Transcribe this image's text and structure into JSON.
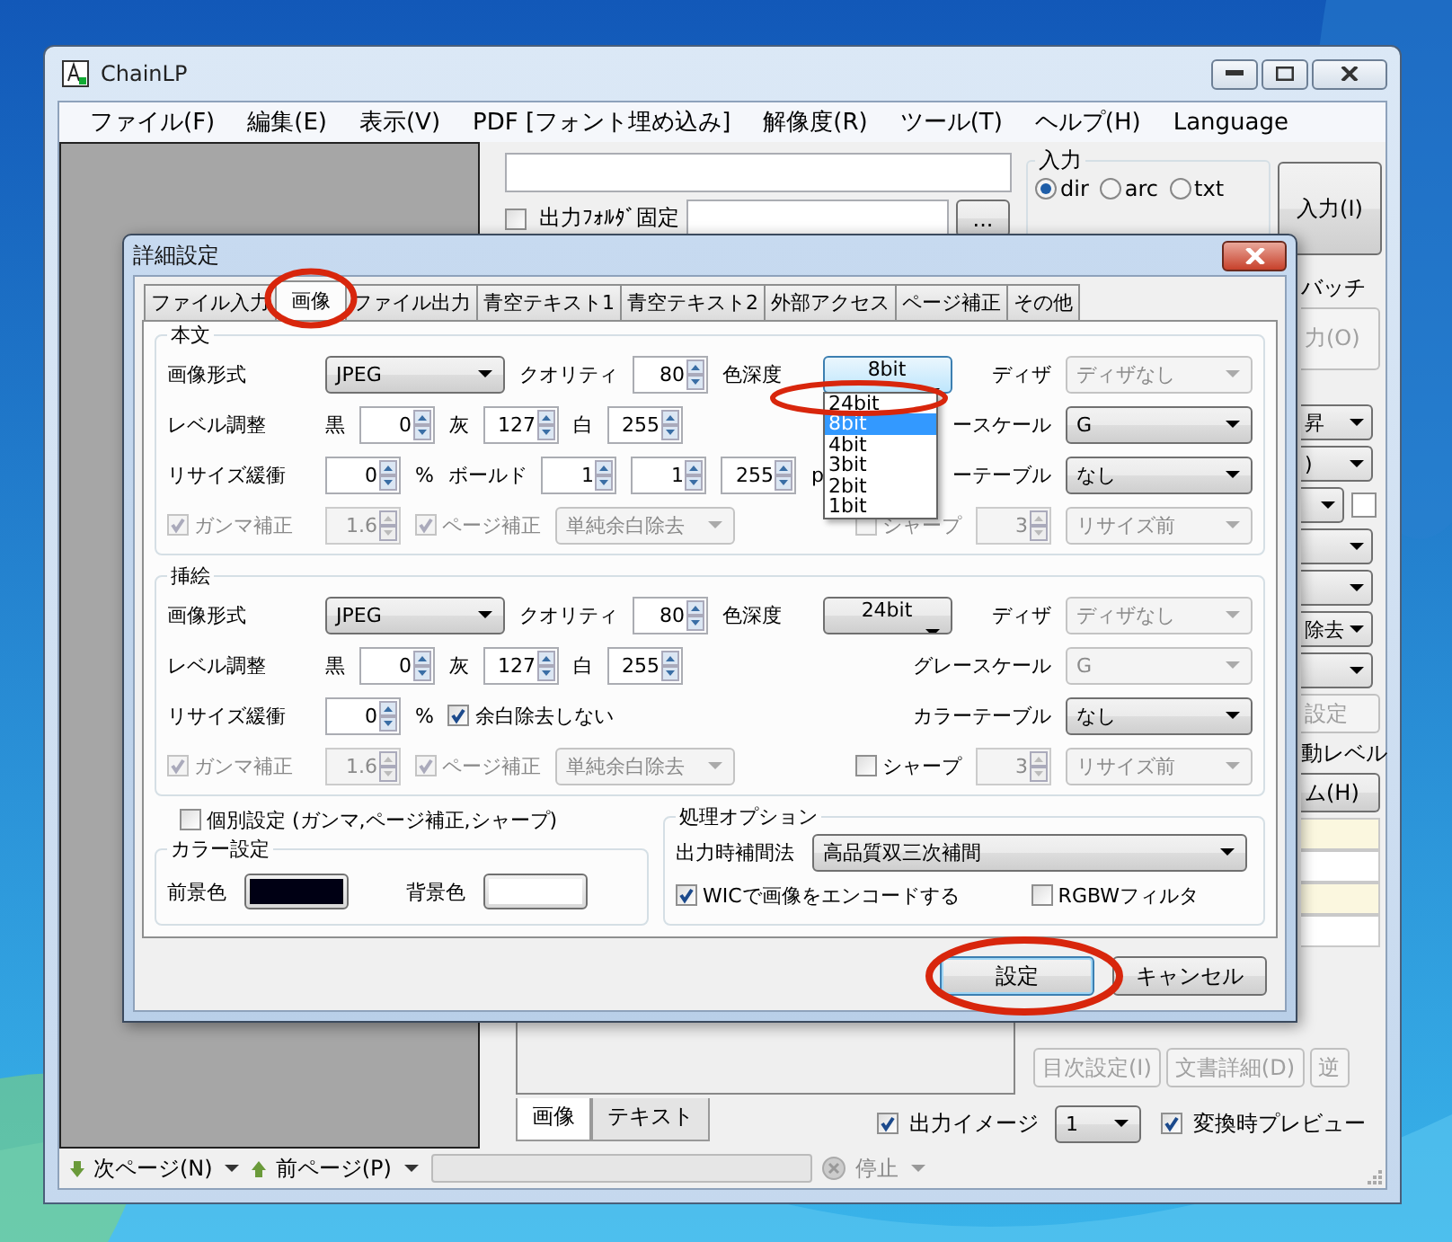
{
  "window": {
    "title": "ChainLP"
  },
  "menu": [
    "ファイル(F)",
    "編集(E)",
    "表示(V)",
    "PDF [フォント埋め込み]",
    "解像度(R)",
    "ツール(T)",
    "ヘルプ(H)",
    "Language"
  ],
  "output_folder": {
    "label": "出力ﾌｫﾙﾀﾞ固定",
    "checked": false,
    "browse": "..."
  },
  "input_group": {
    "title": "入力",
    "options": [
      {
        "label": "dir",
        "selected": true
      },
      {
        "label": "arc",
        "selected": false
      },
      {
        "label": "txt",
        "selected": false
      }
    ],
    "button": "入力(I)"
  },
  "side_strip": [
    {
      "kind": "label",
      "text": "バッチ"
    },
    {
      "kind": "button",
      "text": "力(O)",
      "disabled": true
    },
    {
      "kind": "select",
      "text": "昇"
    },
    {
      "kind": "select",
      "text": ")"
    },
    {
      "kind": "select-check",
      "checked": false
    },
    {
      "kind": "select"
    },
    {
      "kind": "select"
    },
    {
      "kind": "select",
      "text": "除去"
    },
    {
      "kind": "select"
    },
    {
      "kind": "button",
      "text": "設定",
      "disabled": true
    },
    {
      "kind": "label",
      "text": "動レベル"
    },
    {
      "kind": "button",
      "text": "ム(H)",
      "disabled": false
    },
    {
      "kind": "field",
      "color": "#fbf7df"
    },
    {
      "kind": "field",
      "color": "#ffffff"
    },
    {
      "kind": "field",
      "color": "#fbf7df"
    },
    {
      "kind": "field",
      "color": "#ffffff"
    }
  ],
  "doc_buttons": [
    {
      "label": "目次設定(I)",
      "disabled": true
    },
    {
      "label": "文書詳細(D)",
      "disabled": true
    },
    {
      "label": "逆",
      "disabled": true
    }
  ],
  "bottom_tabs": [
    {
      "label": "画像",
      "selected": true
    },
    {
      "label": "テキスト",
      "selected": false
    }
  ],
  "output_image": {
    "label": "出力イメージ",
    "checked": true,
    "value": "1"
  },
  "preview": {
    "label": "変換時プレビュー",
    "checked": true
  },
  "status_bar": {
    "next": "次ページ(N)",
    "prev": "前ページ(P)",
    "stop": "停止"
  },
  "dialog": {
    "title": "詳細設定",
    "tabs": [
      {
        "label": "ファイル入力",
        "selected": false
      },
      {
        "label": "画像",
        "selected": true
      },
      {
        "label": "ファイル出力",
        "selected": false
      },
      {
        "label": "青空テキスト1",
        "selected": false
      },
      {
        "label": "青空テキスト2",
        "selected": false
      },
      {
        "label": "外部アクセス",
        "selected": false
      },
      {
        "label": "ページ補正",
        "selected": false
      },
      {
        "label": "その他",
        "selected": false
      }
    ],
    "groups": [
      {
        "title": "本文",
        "rows": [
          {
            "left": [
              {
                "kind": "label",
                "text": "画像形式"
              },
              {
                "kind": "select",
                "value": "JPEG",
                "disabled": false
              },
              {
                "kind": "label",
                "text": "クオリティ"
              },
              {
                "kind": "spin",
                "value": "80",
                "disabled": false
              },
              {
                "kind": "label",
                "text": "色深度"
              },
              {
                "kind": "select",
                "value": "8bit",
                "disabled": false,
                "open": true,
                "options": [
                  {
                    "label": "24bit",
                    "selected": false
                  },
                  {
                    "label": "8bit",
                    "selected": true
                  },
                  {
                    "label": "4bit",
                    "selected": false
                  },
                  {
                    "label": "3bit",
                    "selected": false
                  },
                  {
                    "label": "2bit",
                    "selected": false
                  },
                  {
                    "label": "1bit",
                    "selected": false
                  }
                ]
              }
            ],
            "right": [
              {
                "kind": "label",
                "text": "ディザ"
              },
              {
                "kind": "select",
                "value": "ディザなし",
                "disabled": true
              }
            ]
          },
          {
            "left": [
              {
                "kind": "label",
                "text": "レベル調整"
              },
              {
                "kind": "label",
                "text": "黒"
              },
              {
                "kind": "spin",
                "value": "0",
                "disabled": false
              },
              {
                "kind": "label",
                "text": "灰"
              },
              {
                "kind": "spin",
                "value": "127",
                "disabled": false
              },
              {
                "kind": "label",
                "text": "白"
              },
              {
                "kind": "spin",
                "value": "255",
                "disabled": false
              }
            ],
            "right": [
              {
                "kind": "label",
                "text": "ースケール"
              },
              {
                "kind": "select",
                "value": "G",
                "disabled": false
              }
            ]
          },
          {
            "left": [
              {
                "kind": "label",
                "text": "リサイズ緩衝"
              },
              {
                "kind": "spin",
                "value": "0",
                "disabled": false
              },
              {
                "kind": "label",
                "text": "%"
              },
              {
                "kind": "label",
                "text": "ボールド"
              },
              {
                "kind": "spin",
                "value": "1",
                "disabled": false
              },
              {
                "kind": "spin",
                "value": "1",
                "disabled": false
              },
              {
                "kind": "spin",
                "value": "255",
                "disabled": false
              },
              {
                "kind": "label",
                "text": "p"
              }
            ],
            "right": [
              {
                "kind": "label",
                "text": "ーテーブル"
              },
              {
                "kind": "select",
                "value": "なし",
                "disabled": false
              }
            ]
          },
          {
            "left": [
              {
                "kind": "check",
                "label": "ガンマ補正",
                "checked": true,
                "disabled": true
              },
              {
                "kind": "spin",
                "value": "1.6",
                "disabled": true
              },
              {
                "kind": "check",
                "label": "ページ補正",
                "checked": true,
                "disabled": true
              },
              {
                "kind": "select",
                "value": "単純余白除去",
                "disabled": true
              }
            ],
            "right": [
              {
                "kind": "check",
                "label": "シャープ",
                "checked": false,
                "disabled": true
              },
              {
                "kind": "spin",
                "value": "3",
                "disabled": true
              },
              {
                "kind": "select",
                "value": "リサイズ前",
                "disabled": true
              }
            ]
          }
        ]
      },
      {
        "title": "挿絵",
        "rows": [
          {
            "left": [
              {
                "kind": "label",
                "text": "画像形式"
              },
              {
                "kind": "select",
                "value": "JPEG",
                "disabled": false
              },
              {
                "kind": "label",
                "text": "クオリティ"
              },
              {
                "kind": "spin",
                "value": "80",
                "disabled": false
              },
              {
                "kind": "label",
                "text": "色深度"
              },
              {
                "kind": "select",
                "value": "24bit",
                "disabled": false
              }
            ],
            "right": [
              {
                "kind": "label",
                "text": "ディザ"
              },
              {
                "kind": "select",
                "value": "ディザなし",
                "disabled": true
              }
            ]
          },
          {
            "left": [
              {
                "kind": "label",
                "text": "レベル調整"
              },
              {
                "kind": "label",
                "text": "黒"
              },
              {
                "kind": "spin",
                "value": "0",
                "disabled": false
              },
              {
                "kind": "label",
                "text": "灰"
              },
              {
                "kind": "spin",
                "value": "127",
                "disabled": false
              },
              {
                "kind": "label",
                "text": "白"
              },
              {
                "kind": "spin",
                "value": "255",
                "disabled": false
              }
            ],
            "right": [
              {
                "kind": "label",
                "text": "グレースケール"
              },
              {
                "kind": "select",
                "value": "G",
                "disabled": true
              }
            ]
          },
          {
            "left": [
              {
                "kind": "label",
                "text": "リサイズ緩衝"
              },
              {
                "kind": "spin",
                "value": "0",
                "disabled": false
              },
              {
                "kind": "label",
                "text": "%"
              },
              {
                "kind": "check",
                "label": "余白除去しない",
                "checked": true,
                "disabled": false
              }
            ],
            "right": [
              {
                "kind": "label",
                "text": "カラーテーブル"
              },
              {
                "kind": "select",
                "value": "なし",
                "disabled": false
              }
            ]
          },
          {
            "left": [
              {
                "kind": "check",
                "label": "ガンマ補正",
                "checked": true,
                "disabled": true
              },
              {
                "kind": "spin",
                "value": "1.6",
                "disabled": true
              },
              {
                "kind": "check",
                "label": "ページ補正",
                "checked": true,
                "disabled": true
              },
              {
                "kind": "select",
                "value": "単純余白除去",
                "disabled": true
              }
            ],
            "right": [
              {
                "kind": "check",
                "label": "シャープ",
                "checked": false,
                "disabled": false
              },
              {
                "kind": "spin",
                "value": "3",
                "disabled": true
              },
              {
                "kind": "select",
                "value": "リサイズ前",
                "disabled": true
              }
            ]
          }
        ]
      }
    ],
    "individual": {
      "label": "個別設定 (ガンマ,ページ補正,シャープ)",
      "checked": false
    },
    "color_settings": {
      "title": "カラー設定",
      "items": [
        {
          "label": "前景色",
          "color": "#000014"
        },
        {
          "label": "背景色",
          "color": "#ffffff"
        }
      ]
    },
    "processing": {
      "title": "処理オプション",
      "interp_label": "出力時補間法",
      "interp": "高品質双三次補間",
      "options": [
        {
          "label": "WICで画像をエンコードする",
          "checked": true
        },
        {
          "label": "RGBWフィルタ",
          "checked": false
        }
      ]
    },
    "buttons": [
      {
        "label": "設定",
        "default": true
      },
      {
        "label": "キャンセル",
        "default": false
      }
    ]
  }
}
